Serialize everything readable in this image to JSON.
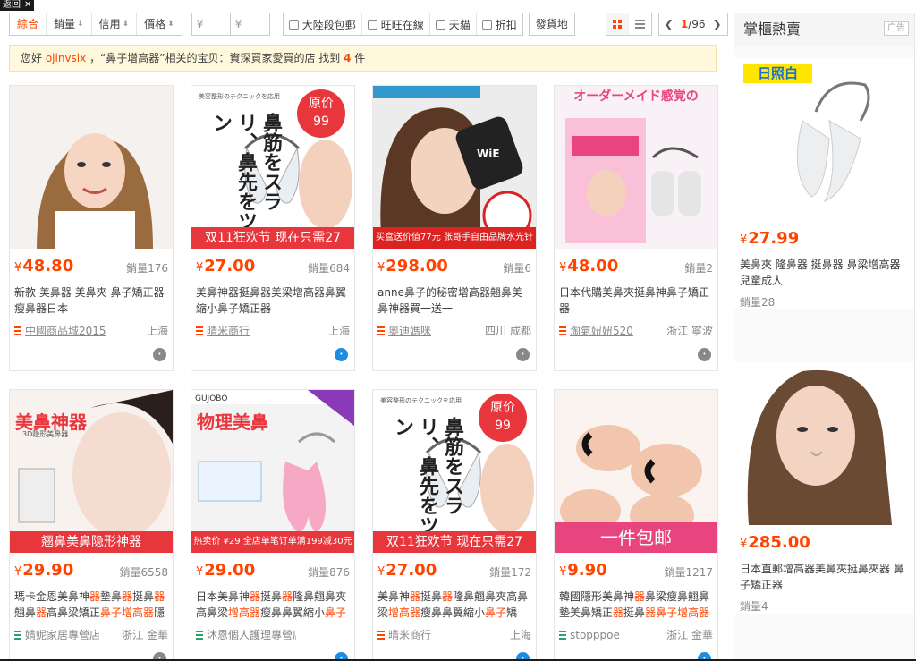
{
  "corner_tag": {
    "label": "返回"
  },
  "toolbar": {
    "sort": [
      {
        "label": "綜合",
        "active": true,
        "arrow": false
      },
      {
        "label": "銷量",
        "active": false,
        "arrow": true
      },
      {
        "label": "信用",
        "active": false,
        "arrow": true
      },
      {
        "label": "價格",
        "active": false,
        "arrow": true
      }
    ],
    "price_from_placeholder": "¥",
    "price_to_placeholder": "¥",
    "filters": [
      "大陸段包郵",
      "旺旺在線",
      "天貓",
      "折扣"
    ],
    "ship_from": "發貨地",
    "pager": {
      "current": "1",
      "total": "/96"
    }
  },
  "notice": {
    "prefix": "您好 ",
    "nick": "ojinvsix",
    "middle": " ，“鼻子增高器”相关的宝贝：資深買家愛買的店 找到 ",
    "count": "4",
    "suffix": " 件"
  },
  "products": [
    {
      "price": "48.80",
      "sales": "銷量176",
      "title": [
        {
          "t": "新款 美鼻器 美鼻夾 鼻子矯正器瘦鼻器日本"
        }
      ],
      "shop": "中國商品城2015",
      "shop_color": "red",
      "loc": "上海",
      "ww_on": false,
      "img": "woman-nose"
    },
    {
      "price": "27.00",
      "sales": "銷量684",
      "title": [
        {
          "t": "美鼻神器挺鼻器美梁增高器鼻翼縮小鼻子矯正器"
        }
      ],
      "shop": "晴米商行",
      "shop_color": "red",
      "loc": "上海",
      "ww_on": true,
      "img": "clip-sale",
      "banner": "双11狂欢节 现在只需27",
      "badge": "原价\n99",
      "vtext": "鼻筋をスラリ、鼻先をツン"
    },
    {
      "price": "298.00",
      "sales": "銷量6",
      "title": [
        {
          "t": "anne鼻子的秘密增高器翹鼻美鼻神器買一送一"
        }
      ],
      "shop": "奧迪媽咪",
      "shop_color": "red",
      "loc": "四川 成都",
      "ww_on": false,
      "img": "woman-device",
      "banner": "买盒送价值77元 张哥手自由品牌水光针一盒"
    },
    {
      "price": "48.00",
      "sales": "銷量2",
      "title": [
        {
          "t": "日本代購美鼻夾挺鼻神鼻子矯正器"
        }
      ],
      "shop": "淘氣妞妞520",
      "shop_color": "red",
      "loc": "浙江 寧波",
      "ww_on": false,
      "img": "pink-box",
      "banner": "オーダーメイド感覚の"
    },
    {
      "price": "29.90",
      "sales": "銷量6558",
      "title": [
        {
          "t": "瑪卡金恩美鼻神"
        },
        {
          "t": "器",
          "hl": true
        },
        {
          "t": "墊鼻"
        },
        {
          "t": "器",
          "hl": true
        },
        {
          "t": "挺鼻"
        },
        {
          "t": "器",
          "hl": true
        },
        {
          "t": "翹鼻"
        },
        {
          "t": "器",
          "hl": true
        },
        {
          "t": "高鼻梁矯正"
        },
        {
          "t": "鼻子增高器",
          "hl": true
        },
        {
          "t": "隱"
        }
      ],
      "shop": "婧妮家居專營店",
      "shop_color": "green",
      "loc": "浙江 金華",
      "ww_on": false,
      "img": "beauty-banner",
      "banner": "翘鼻美鼻隐形神器",
      "title_img": "美鼻神器"
    },
    {
      "price": "29.00",
      "sales": "銷量876",
      "title": [
        {
          "t": "日本美鼻神"
        },
        {
          "t": "器",
          "hl": true
        },
        {
          "t": "挺鼻"
        },
        {
          "t": "器",
          "hl": true
        },
        {
          "t": "隆鼻翹鼻夾高鼻梁"
        },
        {
          "t": "增高器",
          "hl": true
        },
        {
          "t": "瘦鼻鼻翼縮小"
        },
        {
          "t": "鼻子",
          "hl": true
        },
        {
          "t": "夾"
        }
      ],
      "shop": "沐恩個人護理專營店",
      "shop_color": "green",
      "loc": "",
      "ww_on": true,
      "img": "pink-clip",
      "banner": "热卖价 ¥29 全店单笔订单满199减30元",
      "title_img": "物理美鼻"
    },
    {
      "price": "27.00",
      "sales": "銷量172",
      "title": [
        {
          "t": "美鼻神"
        },
        {
          "t": "器",
          "hl": true
        },
        {
          "t": "挺鼻"
        },
        {
          "t": "器",
          "hl": true
        },
        {
          "t": "隆鼻翹鼻夾高鼻梁"
        },
        {
          "t": "增高器",
          "hl": true
        },
        {
          "t": "瘦鼻鼻翼縮小"
        },
        {
          "t": "鼻子",
          "hl": true
        },
        {
          "t": "矯"
        }
      ],
      "shop": "晴米商行",
      "shop_color": "red",
      "loc": "上海",
      "ww_on": true,
      "img": "clip-sale",
      "banner": "双11狂欢节 现在只需27",
      "badge": "原价\n99",
      "vtext": "鼻筋をスラリ、鼻先をツン"
    },
    {
      "price": "9.90",
      "sales": "銷量1217",
      "title": [
        {
          "t": "韓國隱形美鼻神"
        },
        {
          "t": "器",
          "hl": true
        },
        {
          "t": "鼻梁瘦鼻翹鼻墊美鼻矯正"
        },
        {
          "t": "器",
          "hl": true
        },
        {
          "t": "挺鼻"
        },
        {
          "t": "器",
          "hl": true
        },
        {
          "t": "鼻子增高器",
          "hl": true
        }
      ],
      "shop": "stopppoe",
      "shop_color": "green",
      "loc": "浙江 金華",
      "ww_on": true,
      "img": "black-clips",
      "banner": "一件包邮"
    }
  ],
  "side": {
    "title": "掌櫃熱賣",
    "ad": "广告",
    "items": [
      {
        "price": "27.99",
        "title": "美鼻夾 隆鼻器 挺鼻器 鼻梁增高器 兒童成人",
        "sales": "銷量28",
        "tag": "日照白",
        "img": "white-clip"
      },
      {
        "price": "285.00",
        "title": "日本直郵增高器美鼻夾挺鼻夾器 鼻子矯正器",
        "sales": "銷量4",
        "img": "woman-side"
      }
    ]
  },
  "currency": "¥"
}
